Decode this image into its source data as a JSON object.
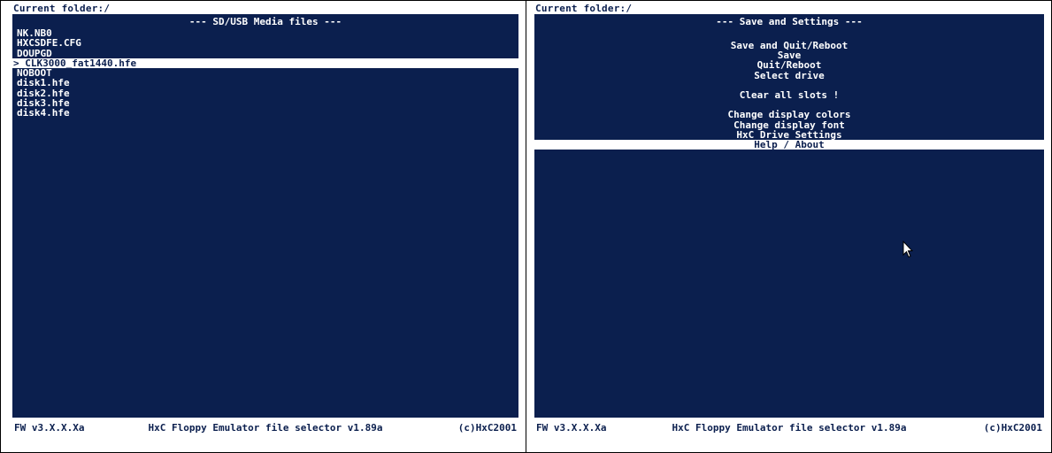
{
  "left": {
    "folder_label": "Current folder:/",
    "title": "--- SD/USB Media files ---",
    "files": [
      {
        "marker": "",
        "name": "NK.NB0"
      },
      {
        "marker": "",
        "name": "HXCSDFE.CFG"
      },
      {
        "marker": "",
        "name": "DOUPGD"
      },
      {
        "marker": "> ",
        "name": "CLK3000_fat1440.hfe"
      },
      {
        "marker": "",
        "name": "NOBOOT"
      },
      {
        "marker": "",
        "name": "disk1.hfe"
      },
      {
        "marker": "",
        "name": "disk2.hfe"
      },
      {
        "marker": "",
        "name": "disk3.hfe"
      },
      {
        "marker": "",
        "name": "disk4.hfe"
      }
    ],
    "selected_index": 3,
    "status": {
      "firmware": "FW v3.X.X.Xa",
      "app_title": "HxC Floppy Emulator file selector v1.89a",
      "copyright": "(c)HxC2001"
    }
  },
  "right": {
    "folder_label": "Current folder:/",
    "title": "--- Save and Settings ---",
    "menu": [
      "Save and Quit/Reboot",
      "Save",
      "Quit/Reboot",
      "Select drive",
      "",
      "Clear all slots !",
      "",
      "Change display colors",
      "Change display font",
      "HxC Drive Settings",
      "Help / About"
    ],
    "selected_index": 10,
    "status": {
      "firmware": "FW v3.X.X.Xa",
      "app_title": "HxC Floppy Emulator file selector v1.89a",
      "copyright": "(c)HxC2001"
    }
  },
  "colors": {
    "background_blue": "#0b1f4e",
    "text_white": "#ffffff"
  }
}
